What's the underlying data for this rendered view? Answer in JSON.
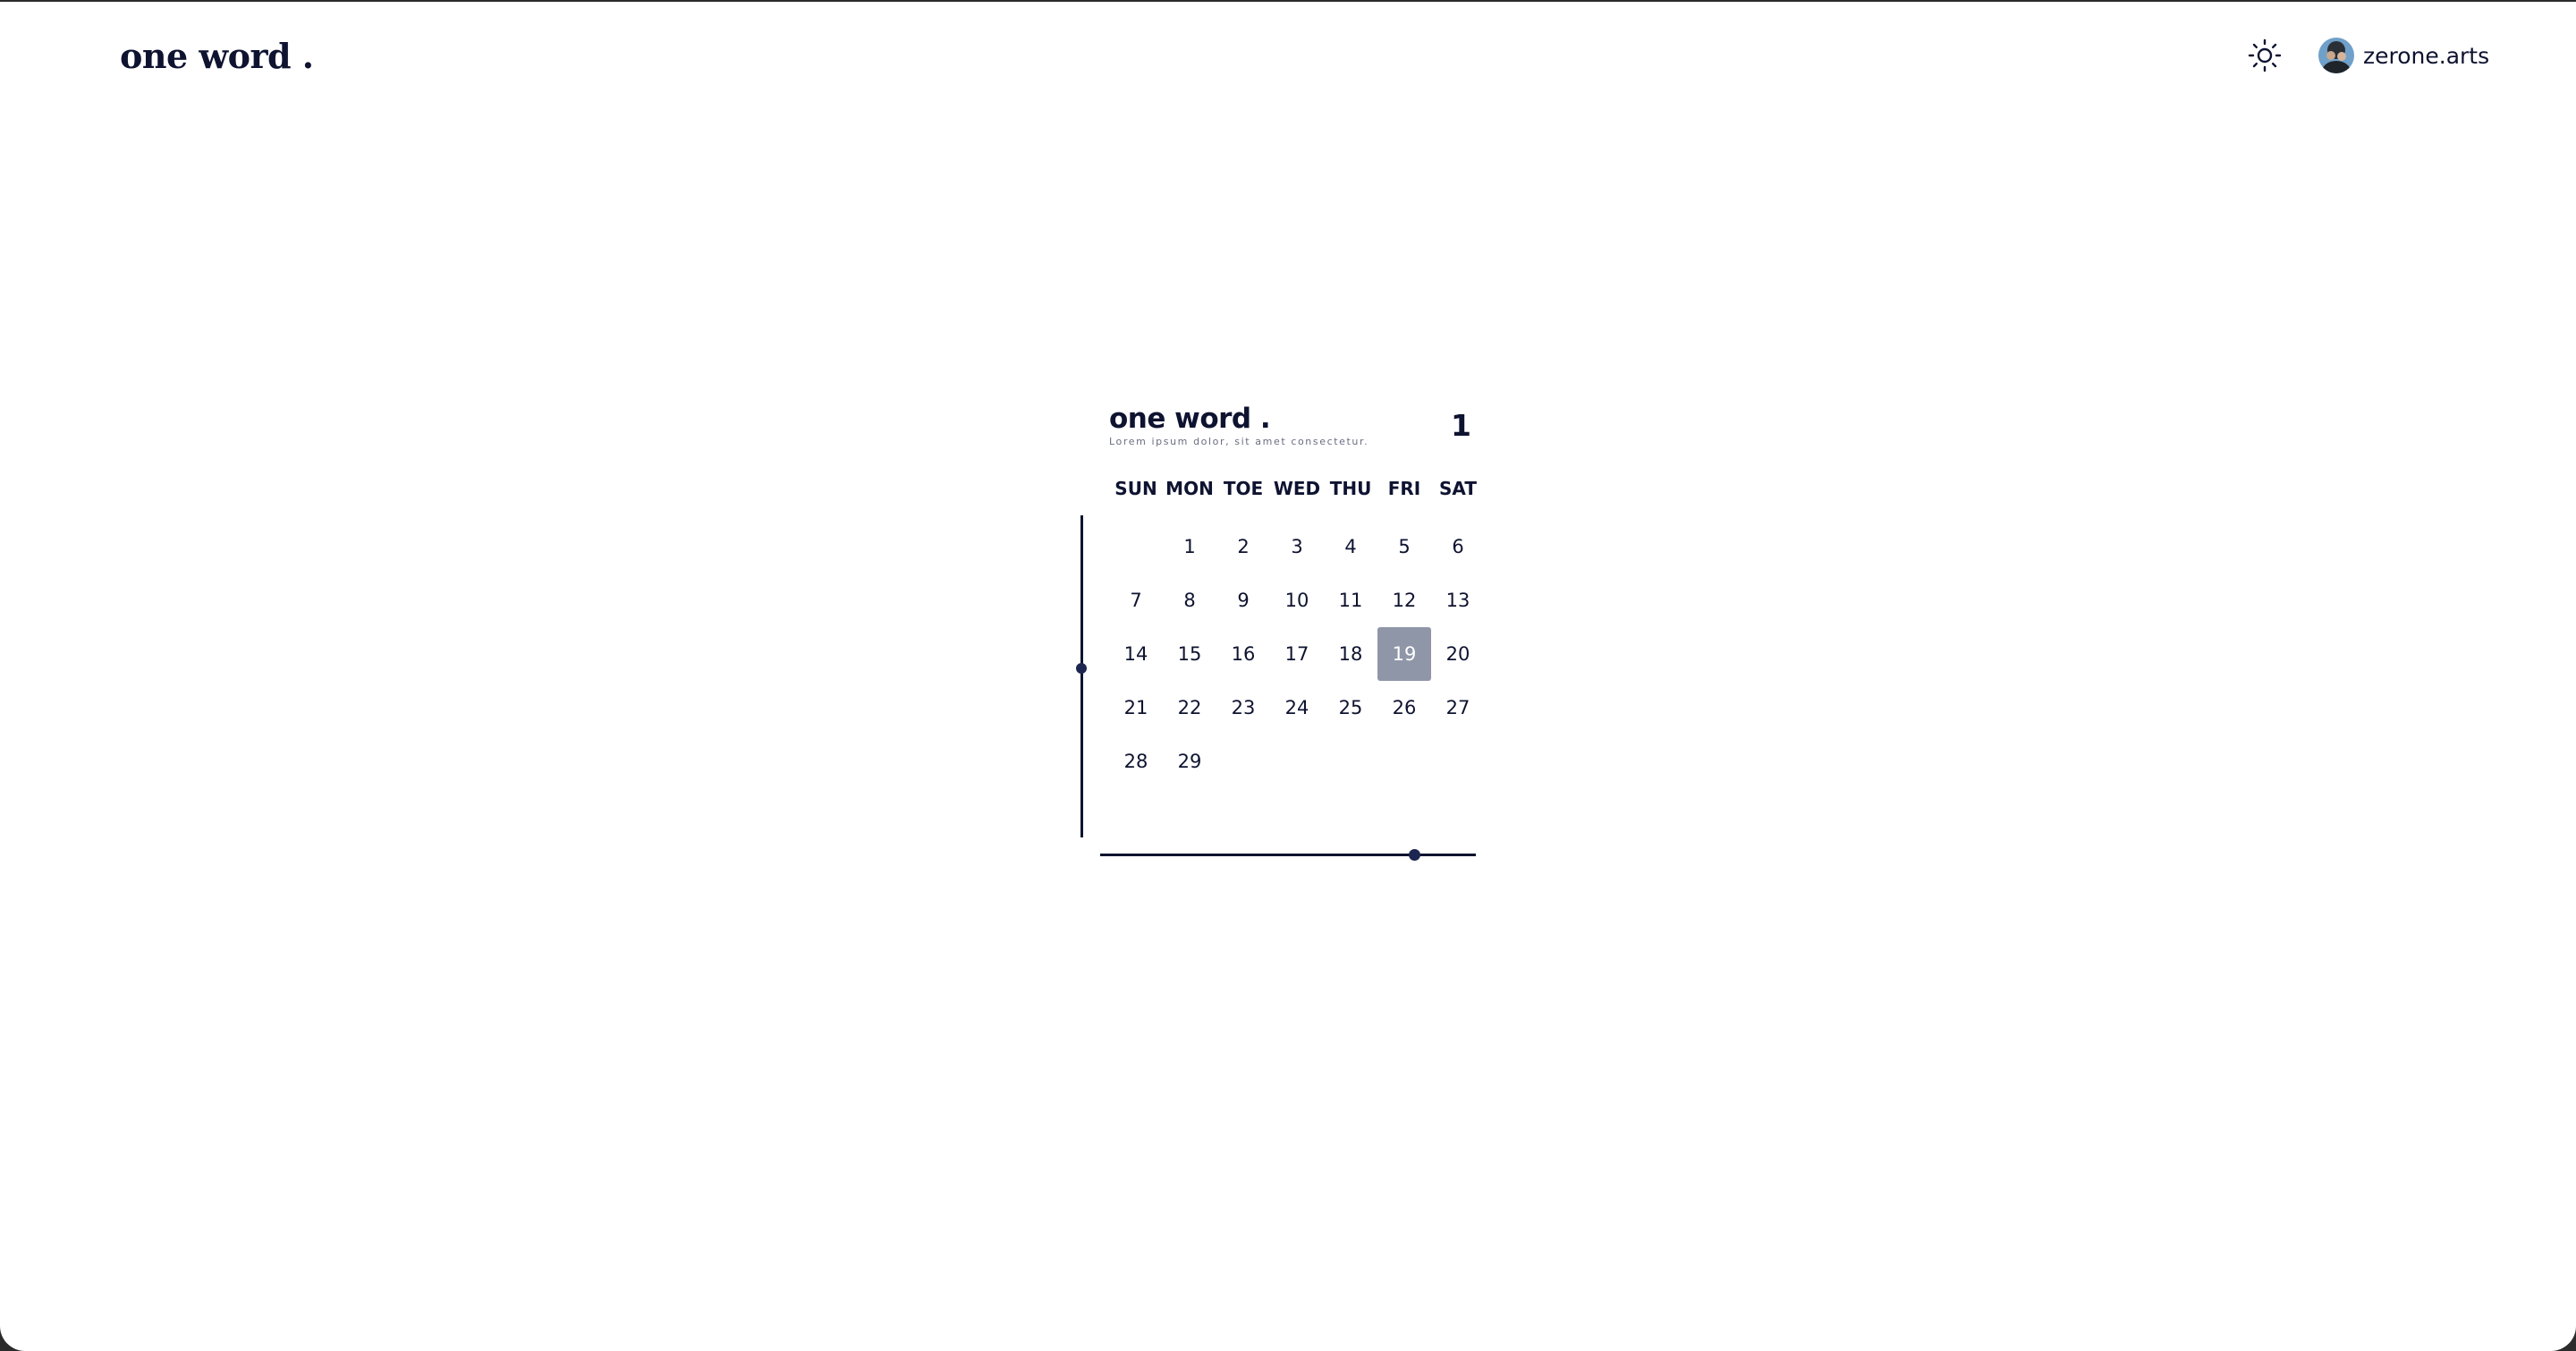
{
  "header": {
    "brand": "one word .",
    "theme_toggle_icon": "sun-icon",
    "user": {
      "name": "zerone.arts",
      "avatar_icon": "avatar-image"
    }
  },
  "calendar": {
    "title": "one word .",
    "subtitle": "Lorem ipsum dolor, sit amet consectetur.",
    "month_number": "1",
    "weekdays": [
      "SUN",
      "MON",
      "TOE",
      "WED",
      "THU",
      "FRI",
      "SAT"
    ],
    "days": [
      "",
      "1",
      "2",
      "3",
      "4",
      "5",
      "6",
      "7",
      "8",
      "9",
      "10",
      "11",
      "12",
      "13",
      "14",
      "15",
      "16",
      "17",
      "18",
      "19",
      "20",
      "21",
      "22",
      "23",
      "24",
      "25",
      "26",
      "27",
      "28",
      "29"
    ],
    "selected_day": "19",
    "selected_color": "#8f96a8"
  },
  "colors": {
    "ink": "#0e1330",
    "accent_dot": "#1c2650",
    "muted": "#6a6d80"
  }
}
